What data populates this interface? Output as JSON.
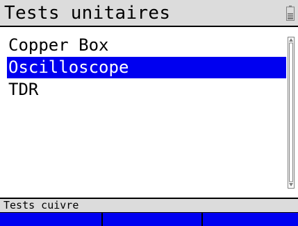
{
  "header": {
    "title": "Tests unitaires",
    "battery_icon": "battery-icon"
  },
  "menu": {
    "items": [
      {
        "label": "Copper Box",
        "selected": false
      },
      {
        "label": "Oscilloscope",
        "selected": true
      },
      {
        "label": "TDR",
        "selected": false
      }
    ]
  },
  "status": {
    "text": "Tests cuivre"
  },
  "softkeys": [
    {
      "label": ""
    },
    {
      "label": ""
    },
    {
      "label": ""
    }
  ],
  "colors": {
    "selection": "#0000f0",
    "bar": "#dcdcdc",
    "softkey": "#0000f0"
  }
}
